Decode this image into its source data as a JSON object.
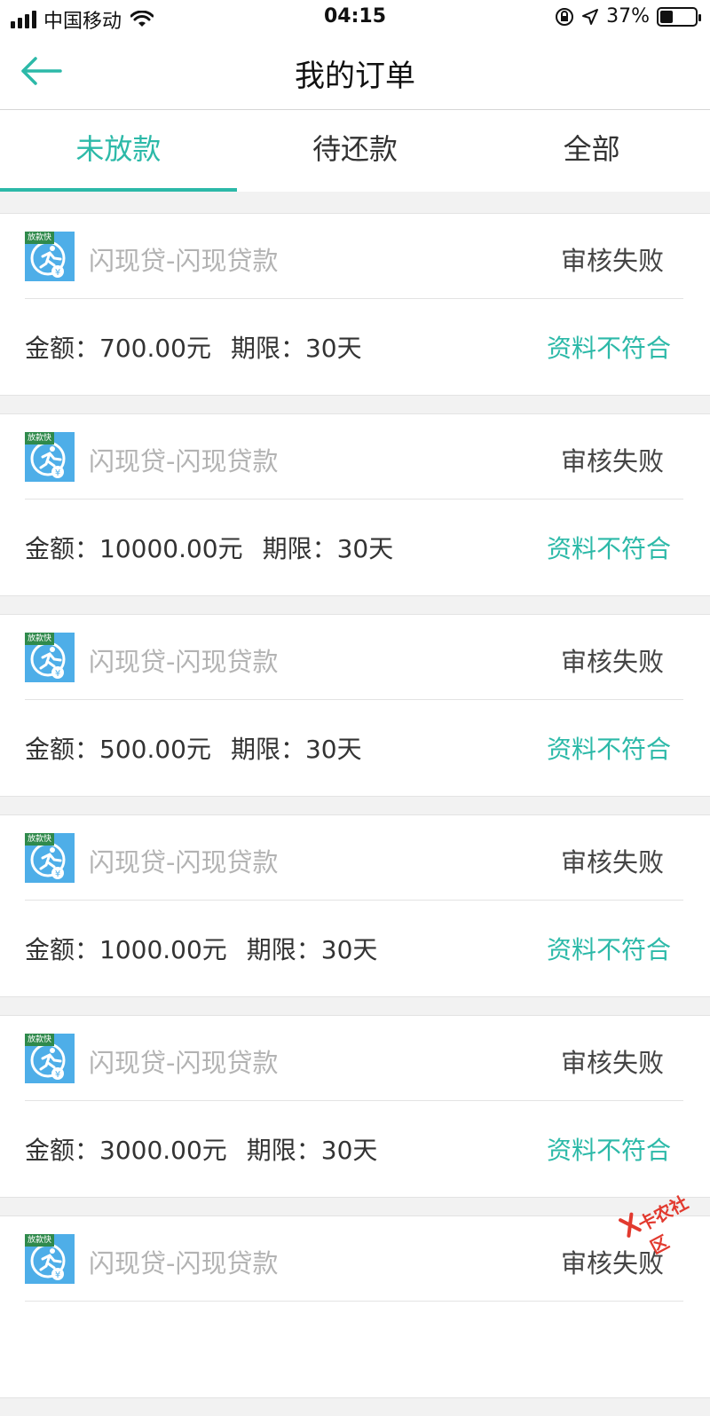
{
  "status_bar": {
    "carrier": "中国移动",
    "time": "04:15",
    "battery_percent": "37%",
    "battery_level": 0.37
  },
  "header": {
    "title": "我的订单"
  },
  "tabs": [
    {
      "label": "未放款",
      "active": true
    },
    {
      "label": "待还款",
      "active": false
    },
    {
      "label": "全部",
      "active": false
    }
  ],
  "orders": [
    {
      "logo_tag": "放款快",
      "product": "闪现贷-闪现贷款",
      "status": "审核失败",
      "amount": "金额：700.00元",
      "term": "期限：30天",
      "reason": "资料不符合"
    },
    {
      "logo_tag": "放款快",
      "product": "闪现贷-闪现贷款",
      "status": "审核失败",
      "amount": "金额：10000.00元",
      "term": "期限：30天",
      "reason": "资料不符合"
    },
    {
      "logo_tag": "放款快",
      "product": "闪现贷-闪现贷款",
      "status": "审核失败",
      "amount": "金额：500.00元",
      "term": "期限：30天",
      "reason": "资料不符合"
    },
    {
      "logo_tag": "放款快",
      "product": "闪现贷-闪现贷款",
      "status": "审核失败",
      "amount": "金额：1000.00元",
      "term": "期限：30天",
      "reason": "资料不符合"
    },
    {
      "logo_tag": "放款快",
      "product": "闪现贷-闪现贷款",
      "status": "审核失败",
      "amount": "金额：3000.00元",
      "term": "期限：30天",
      "reason": "资料不符合"
    },
    {
      "logo_tag": "放款快",
      "product": "闪现贷-闪现贷款",
      "status": "审核失败",
      "amount": "",
      "term": "",
      "reason": ""
    }
  ],
  "watermark": "卡农社区",
  "colors": {
    "accent": "#2cb9a8",
    "logo_bg": "#4eaee8",
    "watermark": "#e23a2f"
  }
}
